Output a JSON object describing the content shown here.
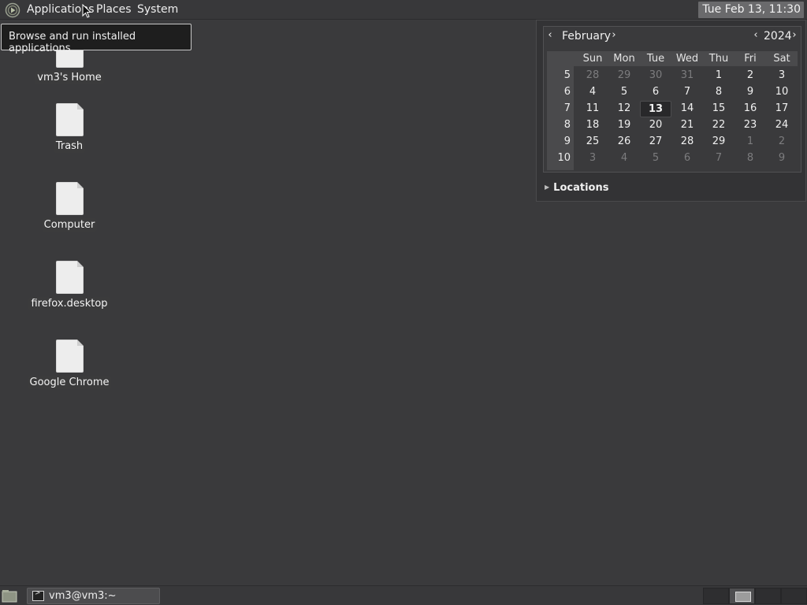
{
  "top_panel": {
    "menus": [
      "Applications",
      "Places",
      "System"
    ],
    "clock": "Tue Feb 13, 11:30"
  },
  "tooltip": "Browse and run installed applications",
  "desktop_icons": [
    {
      "label": "vm3's Home",
      "icon": "home-file-icon"
    },
    {
      "label": "Trash",
      "icon": "trash-file-icon"
    },
    {
      "label": "Computer",
      "icon": "computer-file-icon"
    },
    {
      "label": "firefox.desktop",
      "icon": "firefox-file-icon"
    },
    {
      "label": "Google Chrome",
      "icon": "chrome-file-icon"
    }
  ],
  "calendar": {
    "month": "February",
    "year": "2024",
    "weekdays": [
      "Sun",
      "Mon",
      "Tue",
      "Wed",
      "Thu",
      "Fri",
      "Sat"
    ],
    "weeks": [
      {
        "num": "5",
        "days": [
          "28",
          "29",
          "30",
          "31",
          "1",
          "2",
          "3"
        ],
        "other": [
          true,
          true,
          true,
          true,
          false,
          false,
          false
        ]
      },
      {
        "num": "6",
        "days": [
          "4",
          "5",
          "6",
          "7",
          "8",
          "9",
          "10"
        ],
        "other": [
          false,
          false,
          false,
          false,
          false,
          false,
          false
        ]
      },
      {
        "num": "7",
        "days": [
          "11",
          "12",
          "13",
          "14",
          "15",
          "16",
          "17"
        ],
        "other": [
          false,
          false,
          false,
          false,
          false,
          false,
          false
        ]
      },
      {
        "num": "8",
        "days": [
          "18",
          "19",
          "20",
          "21",
          "22",
          "23",
          "24"
        ],
        "other": [
          false,
          false,
          false,
          false,
          false,
          false,
          false
        ]
      },
      {
        "num": "9",
        "days": [
          "25",
          "26",
          "27",
          "28",
          "29",
          "1",
          "2"
        ],
        "other": [
          false,
          false,
          false,
          false,
          false,
          true,
          true
        ]
      },
      {
        "num": "10",
        "days": [
          "3",
          "4",
          "5",
          "6",
          "7",
          "8",
          "9"
        ],
        "other": [
          true,
          true,
          true,
          true,
          true,
          true,
          true
        ]
      }
    ],
    "today": "13",
    "locations_label": "Locations"
  },
  "bottom_panel": {
    "task_label": "vm3@vm3:~",
    "workspaces": 4,
    "active_workspace": 2
  }
}
